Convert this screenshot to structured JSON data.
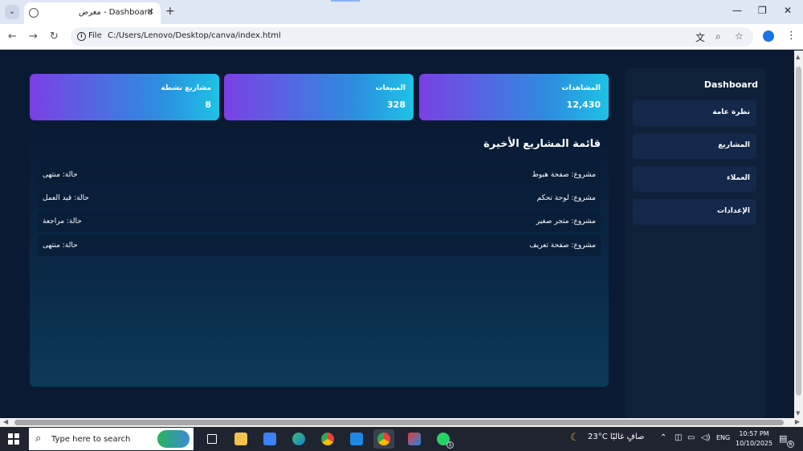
{
  "browser": {
    "tab_title": "معرض - Dashboard",
    "new_tab": "+",
    "tab_close": "✕",
    "address_scheme": "File",
    "address_url": "C:/Users/Lenovo/Desktop/canva/index.html"
  },
  "sidebar": {
    "title": "Dashboard",
    "items": [
      {
        "label": "نظرة عامة"
      },
      {
        "label": "المشاريع"
      },
      {
        "label": "العملاء"
      },
      {
        "label": "الإعدادات"
      }
    ]
  },
  "stats": [
    {
      "label": "المشاهدات",
      "value": "12,430"
    },
    {
      "label": "المبيعات",
      "value": "328"
    },
    {
      "label": "مشاريع نشطة",
      "value": "8"
    }
  ],
  "projects": {
    "title": "قائمة المشاريع الأخيرة",
    "rows": [
      {
        "name": "مشروع: صفحة هبوط",
        "status": "حالة: منتهى"
      },
      {
        "name": "مشروع: لوحة تحكم",
        "status": "حالة: قيد العمل"
      },
      {
        "name": "مشروع: متجر صغير",
        "status": "حالة: مراجعة"
      },
      {
        "name": "مشروع: صفحة تعريف",
        "status": "حالة: منتهى"
      }
    ]
  },
  "taskbar": {
    "search_placeholder": "Type here to search",
    "weather": "23°C  صافٍ غالبًا",
    "language": "ENG",
    "time": "10:57 PM",
    "date": "10/10/2025",
    "whatsapp_badge": "1",
    "notification_count": "6"
  },
  "colors": {
    "page_bg": "#0b1a33",
    "card_gradient_start": "#7b3fe4",
    "card_gradient_end": "#1ec2e6",
    "sidebar_bg": "#0f2139"
  }
}
